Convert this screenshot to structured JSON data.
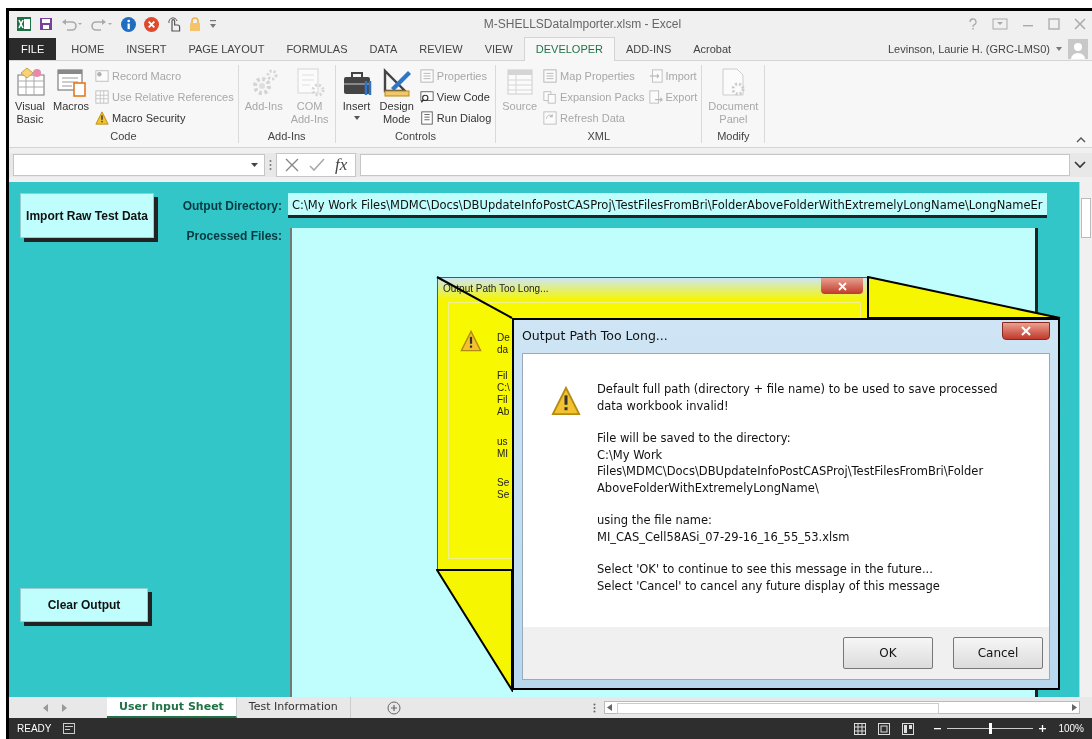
{
  "title_bar": {
    "title": "M-SHELLSDataImporter.xlsm - Excel"
  },
  "ribbon_tabs": [
    {
      "label": "FILE",
      "kind": "file",
      "selected": false
    },
    {
      "label": "HOME",
      "kind": "tab",
      "selected": false
    },
    {
      "label": "INSERT",
      "kind": "tab",
      "selected": false
    },
    {
      "label": "PAGE LAYOUT",
      "kind": "tab",
      "selected": false
    },
    {
      "label": "FORMULAS",
      "kind": "tab",
      "selected": false
    },
    {
      "label": "DATA",
      "kind": "tab",
      "selected": false
    },
    {
      "label": "REVIEW",
      "kind": "tab",
      "selected": false
    },
    {
      "label": "VIEW",
      "kind": "tab",
      "selected": false
    },
    {
      "label": "DEVELOPER",
      "kind": "tab",
      "selected": true
    },
    {
      "label": "ADD-INS",
      "kind": "tab",
      "selected": false
    },
    {
      "label": "Acrobat",
      "kind": "tab",
      "selected": false
    }
  ],
  "account": {
    "name": "Levinson, Laurie H. (GRC-LMS0)"
  },
  "ribbon_groups": [
    {
      "label": "Code",
      "items": [
        {
          "kind": "large",
          "label": "Visual\nBasic",
          "disabled": false,
          "dropdown": false
        },
        {
          "kind": "large",
          "label": "Macros",
          "disabled": false,
          "dropdown": false
        },
        {
          "kind": "stack",
          "items": [
            {
              "label": "Record Macro",
              "disabled": true
            },
            {
              "label": "Use Relative References",
              "disabled": true
            },
            {
              "label": "Macro Security",
              "disabled": false
            }
          ]
        }
      ]
    },
    {
      "label": "Add-Ins",
      "items": [
        {
          "kind": "large",
          "label": "Add-Ins",
          "disabled": true,
          "dropdown": false
        },
        {
          "kind": "large",
          "label": "COM\nAdd-Ins",
          "disabled": true,
          "dropdown": false
        }
      ]
    },
    {
      "label": "Controls",
      "items": [
        {
          "kind": "large",
          "label": "Insert",
          "disabled": false,
          "dropdown": true
        },
        {
          "kind": "large",
          "label": "Design\nMode",
          "disabled": false,
          "dropdown": false
        },
        {
          "kind": "stack",
          "items": [
            {
              "label": "Properties",
              "disabled": true
            },
            {
              "label": "View Code",
              "disabled": false
            },
            {
              "label": "Run Dialog",
              "disabled": false
            }
          ]
        }
      ]
    },
    {
      "label": "XML",
      "items": [
        {
          "kind": "large",
          "label": "Source",
          "disabled": true,
          "dropdown": false
        },
        {
          "kind": "stack",
          "items": [
            {
              "label": "Map Properties",
              "disabled": true
            },
            {
              "label": "Expansion Packs",
              "disabled": true
            },
            {
              "label": "Refresh Data",
              "disabled": true
            }
          ]
        },
        {
          "kind": "stack",
          "items": [
            {
              "label": "Import",
              "disabled": true
            },
            {
              "label": "Export",
              "disabled": true
            }
          ]
        }
      ]
    },
    {
      "label": "Modify",
      "items": [
        {
          "kind": "large",
          "label": "Document\nPanel",
          "disabled": true,
          "dropdown": false
        }
      ]
    }
  ],
  "formula_bar": {
    "function_label": "fx"
  },
  "sheet": {
    "import_button": "Import Raw Test Data",
    "clear_button": "Clear Output",
    "output_directory": {
      "label": "Output Directory:",
      "value": "C:\\My Work Files\\MDMC\\Docs\\DBUpdateInfoPostCASProj\\TestFilesFromBri\\FolderAboveFolderWithExtremelyLongName\\LongNameEr"
    },
    "processed_files": {
      "label": "Processed Files:"
    }
  },
  "back_dialog": {
    "title": "Output Path Too Long...",
    "fragments": [
      [
        "De",
        "da"
      ],
      [
        "Fil",
        "C:\\",
        "Fil",
        "Ab"
      ],
      [
        "us",
        "MI"
      ],
      [
        "Se",
        "Se"
      ]
    ]
  },
  "dialog": {
    "title": "Output Path Too Long...",
    "paragraphs": [
      [
        "Default full path (directory + file name) to be used to save processed",
        "data workbook invalid!"
      ],
      [
        "File will be saved to the directory:",
        "C:\\My Work",
        "Files\\MDMC\\Docs\\DBUpdateInfoPostCASProj\\TestFilesFromBri\\Folder",
        "AboveFolderWithExtremelyLongName\\"
      ],
      [
        "using the file name:",
        "MI_CAS_Cell58ASi_07-29-16_16_55_53.xlsm"
      ],
      [
        "Select 'OK' to continue to see this message in the future...",
        "Select 'Cancel' to cancel any future display of this message"
      ]
    ],
    "buttons": [
      "OK",
      "Cancel"
    ]
  },
  "sheet_tabs": [
    {
      "label": "User Input Sheet",
      "selected": true
    },
    {
      "label": "Test Information",
      "selected": false
    }
  ],
  "status_bar": {
    "mode": "READY",
    "zoom": {
      "level": 0.5,
      "reading": "100%"
    }
  }
}
